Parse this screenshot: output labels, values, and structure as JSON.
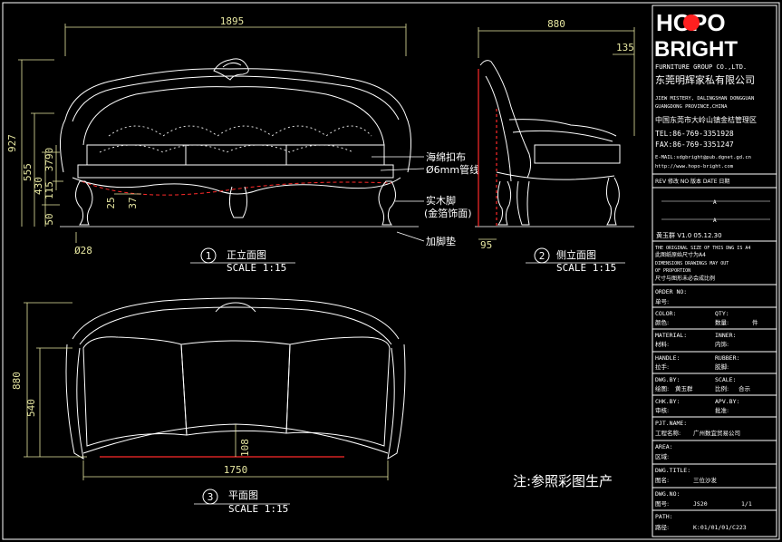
{
  "colors": {
    "background": "#000000",
    "line": "#ffffff",
    "dimension": "#e6e6a0",
    "accent_red": "#ff2a2a",
    "logo_red": "#ff2020"
  },
  "front_view": {
    "dim_width": "1895",
    "dim_height_total": "927",
    "dim_555": "555",
    "dim_430": "430",
    "dim_3790": "3790",
    "dim_115": "115",
    "dim_50": "50",
    "dim_25": "25",
    "dim_37": "37",
    "dim_leg": "Ø28",
    "callout_1": "海绵扣布",
    "callout_2": "Ø6mm管线",
    "callout_3": "实木脚",
    "callout_4": "(金箔饰面)",
    "callout_5": "加脚垫",
    "label_number": "1",
    "label_title": "正立面图",
    "label_scale": "SCALE 1:15"
  },
  "side_view": {
    "dim_depth": "880",
    "dim_135": "135",
    "dim_95": "95",
    "label_number": "2",
    "label_title": "侧立面图",
    "label_scale": "SCALE 1:15"
  },
  "plan_view": {
    "dim_depth": "880",
    "dim_540": "540",
    "dim_width": "1750",
    "dim_108": "108",
    "label_number": "3",
    "label_title": "平面图",
    "label_scale": "SCALE 1:15"
  },
  "note": "注:参照彩图生产",
  "title_block": {
    "logo_line1": "HOPO",
    "logo_line2": "BRIGHT",
    "company_en": "FURNITURE GROUP CO.,LTD.",
    "company_cn": "东莞明辉家私有限公司",
    "address_en_1": "JIEW MISTERY, DALINGSHAN DONGGUAN",
    "address_en_2": "GUANGDONG PROVINCE,CHINA",
    "address_cn": "中国东莞市大岭山镇金桔管理区",
    "tel": "TEL:86-769-3351928",
    "fax": "FAX:86-769-3351247",
    "email": "E-MAIL:sdgbright@pub.dgnet.gd.cn",
    "web": "http://www.hopo-bright.com",
    "rev_header": "REV 修改   NO 版本   DATE 日期",
    "rev_row": "黄玉群   V1.0    05.12.30",
    "rev_dash_1": "A",
    "rev_dash_2": "A",
    "note_en_1": "THE ORIGINAL SIZE OF THIS DWG IS A4",
    "note_cn_1": "此图纸原始尺寸为A4",
    "note_en_2": "DIMENSIONS DRAWINGS MAY OUT",
    "note_en_3": "OF PROPORTION",
    "note_cn_2": "尺寸与图形未必会成比例",
    "order_en": "ORDER NO:",
    "order_cn": "单号:",
    "color_en": "COLOR:",
    "color_cn": "颜色:",
    "qty_en": "QTY:",
    "qty_cn": "数量:",
    "qty_val": "件",
    "material_en": "MATERIAL:",
    "material_cn": "材料:",
    "inner_en": "INNER:",
    "inner_cn": "内饰:",
    "handle_en": "HANDLE:",
    "handle_cn": "拉手:",
    "rubber_en": "RUBBER:",
    "rubber_cn": "胶脚:",
    "dwg_by_en": "DWG.BY:",
    "dwg_by_cn": "绘图:",
    "dwg_by_val": "黄玉群",
    "scale_en": "SCALE:",
    "scale_cn": "比例:",
    "scale_val": "合示",
    "chk_en": "CHK.BY:",
    "chk_cn": "审核:",
    "apv_en": "APV.BY:",
    "apv_cn": "批准:",
    "pjt_en": "PJT.NAME:",
    "pjt_cn": "工程名称:",
    "pjt_val": "广州数宜贸易公司",
    "area_en": "AREA:",
    "area_cn": "区域:",
    "title_en": "DWG.TITLE:",
    "title_cn": "图名:",
    "title_val": "三位沙发",
    "dwgno_en": "DWG.NO:",
    "dwgno_cn": "图号:",
    "dwgno_val": "JS20",
    "sheet_val": "1/1",
    "path_en": "PATH:",
    "path_cn": "路径:",
    "path_val": "K:01/01/01/C223"
  }
}
